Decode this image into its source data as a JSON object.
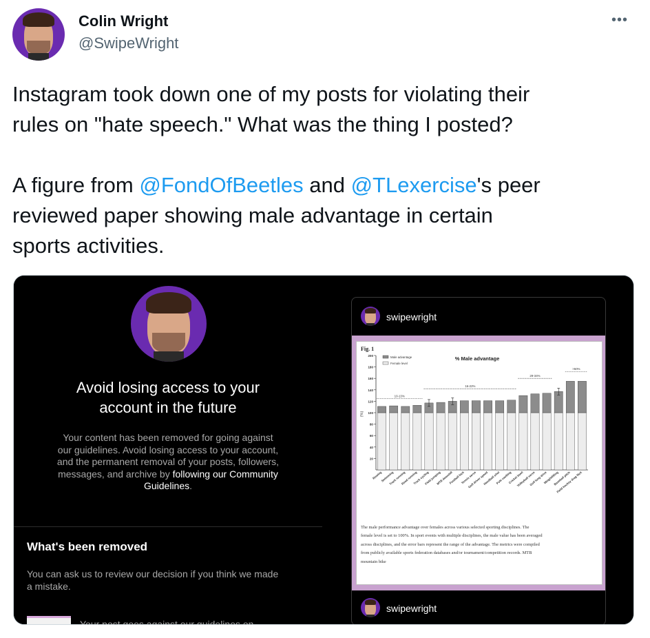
{
  "author": {
    "name": "Colin Wright",
    "handle": "@SwipeWright",
    "more_icon": "more-dots-icon"
  },
  "tweet": {
    "line1": "Instagram took down one of my posts for violating their",
    "line2": "rules on \"hate speech.\" What was the thing I posted?",
    "line3_prefix": "A figure from ",
    "mention1": "@FondOfBeetles",
    "line3_mid": " and ",
    "mention2": "@TLexercise",
    "line3_suffix": "'s peer",
    "line4": "reviewed paper showing male advantage in certain",
    "line5": "sports activities."
  },
  "left_panel": {
    "heading_line1": "Avoid losing access to your",
    "heading_line2": "account in the future",
    "body_line1": "Your content has been removed for going against",
    "body_line2": "our guidelines. Avoid losing access to your account,",
    "body_line3": "and the permanent removal of your posts, followers,",
    "body_line4_prefix": "messages, and archive by ",
    "body_link1": "following our Community",
    "body_link2": "Guidelines",
    "body_end": ".",
    "removed_title": "What's been removed",
    "removed_line1": "You can ask us to review our decision if you think we made",
    "removed_line2": "a mistake.",
    "cut_text": "Your post goes against our guidelines on"
  },
  "right_panel": {
    "username_top": "swipewright",
    "username_bottom": "swipewright",
    "fig_label": "Fig. 1",
    "caption_line1": "The male performance advantage over females across various selected sporting disciplines. The",
    "caption_line2": "female level is set to 100%. In sport events with multiple disciplines, the male value has been averaged",
    "caption_line3": "across disciplines, and the error bars represent the range of the advantage. The metrics were compiled",
    "caption_line4": "from publicly available sports federation databases and/or tournament/competition records. MTB",
    "caption_line5": "mountain bike"
  },
  "colors": {
    "mention": "#1d9bf0",
    "ig_frame": "#c8a2cf",
    "male_bar": "#8c8c8c",
    "female_bar": "#ededed"
  },
  "chart_data": {
    "type": "bar",
    "title": "% Male advantage",
    "ylabel": "(%)",
    "ylim": [
      0,
      200
    ],
    "yticks": [
      20,
      40,
      60,
      80,
      100,
      120,
      140,
      160,
      180,
      200
    ],
    "legend": [
      "Male advantage",
      "Female level"
    ],
    "legend_position": "top-left",
    "categories": [
      "Rowing",
      "Swimming",
      "Track running",
      "Road running",
      "Track cycling",
      "Field jumping",
      "MTB downhill",
      "Football kick",
      "Tennis serve",
      "Golf driver speed",
      "Handball shot",
      "Pole vaulting",
      "Cricket bowl",
      "Volleyball serve",
      "Golf long drive",
      "Weightlifting",
      "Baseball pitch",
      "Field hockey drag flick"
    ],
    "series": [
      {
        "name": "Female level",
        "values": [
          100,
          100,
          100,
          100,
          100,
          100,
          100,
          100,
          100,
          100,
          100,
          100,
          100,
          100,
          100,
          100,
          100,
          100
        ]
      },
      {
        "name": "Male advantage",
        "values": [
          11,
          12,
          11,
          13,
          17,
          18,
          20,
          21,
          21,
          21,
          21,
          22,
          30,
          33,
          34,
          37,
          55,
          55
        ]
      }
    ],
    "annotations": [
      {
        "text": "10-13%",
        "from": "Rowing",
        "to": "Road running",
        "y": 125
      },
      {
        "text": "16-22%",
        "from": "Track cycling",
        "to": "Pole vaulting",
        "y": 142
      },
      {
        "text": "29-34%",
        "from": "Cricket bowl",
        "to": "Golf long drive",
        "y": 160
      },
      {
        "text": ">50%",
        "from": "Baseball pitch",
        "to": "Field hockey drag flick",
        "y": 172
      }
    ]
  }
}
